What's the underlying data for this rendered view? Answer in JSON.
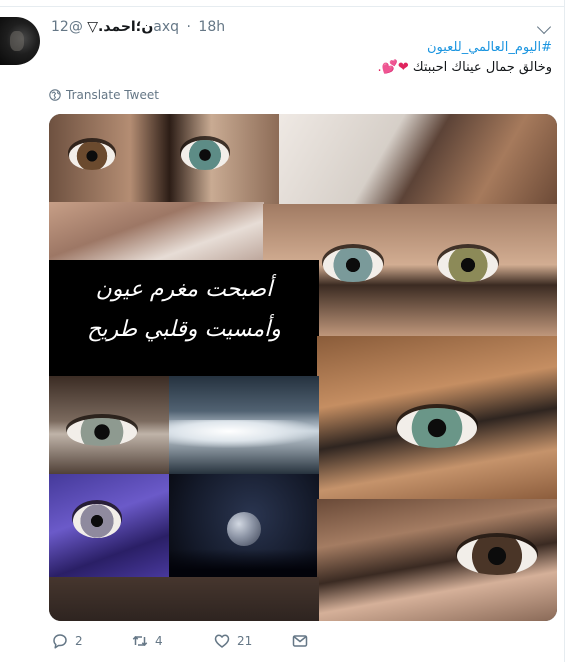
{
  "tweet": {
    "author_name": "ن؛احمد.▽",
    "handle": "@12axq",
    "separator": "·",
    "time": "18h",
    "hashtag": "#اليوم_العالمي_للعيون",
    "text": "وخالق جمال عيناك احببتك",
    "emoji": "❤💕.",
    "translate_label": "Translate Tweet"
  },
  "media": {
    "quote_line_1": "أصبحت مغرم عيون",
    "quote_line_2": "وأمسيت وقلبي طريح"
  },
  "actions": {
    "replies": "2",
    "retweets": "4",
    "likes": "21"
  },
  "colors": {
    "link": "#1b95e0",
    "muted": "#657786",
    "heart": "#e0245e"
  }
}
